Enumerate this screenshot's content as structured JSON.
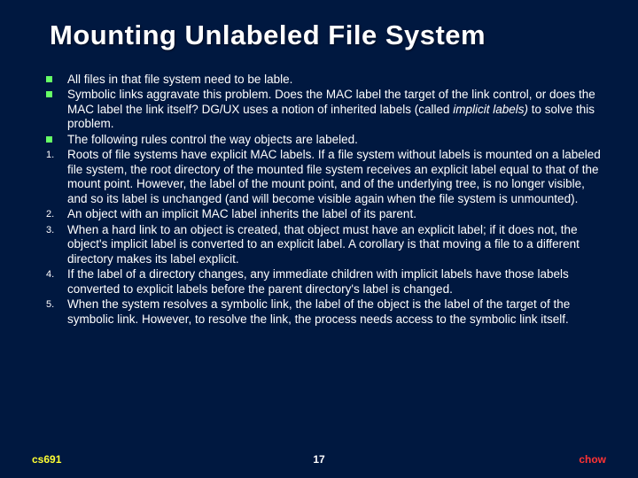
{
  "title": "Mounting Unlabeled File System",
  "bullets": {
    "b1": "All files in that file system need to be lable.",
    "b2a": "Symbolic links aggravate this problem. Does the MAC label the target of the link control, or does the MAC label the link itself? DG/UX uses a notion of inherited labels (called ",
    "b2_italic": "implicit labels)",
    "b2b": " to solve this problem.",
    "b3": "The following rules control the way objects are labeled."
  },
  "numbered": {
    "n1": "Roots of file systems have explicit MAC labels. If a file system without labels is mounted on a labeled file system, the root directory of the mounted file system receives an explicit label equal to that of the mount point. However, the label of the mount point, and of the underlying tree, is no longer visible, and so its label is unchanged (and will become visible again when the file system is unmounted).",
    "n2": "An object with an implicit MAC label inherits the label of its parent.",
    "n3": "When a hard link to an object is created, that object must have an explicit label; if it does not, the object's implicit label is converted to an explicit label. A corollary is that moving a file to a different directory makes its label explicit.",
    "n4": "If the label of a directory changes, any immediate children with implicit labels have those labels converted to explicit labels before the parent directory's label is changed.",
    "n5": "When the system resolves a symbolic link, the label of the object is the label of the target of the symbolic link. However, to resolve the link, the process needs access to the symbolic link itself."
  },
  "markers": {
    "m1": "1.",
    "m2": "2.",
    "m3": "3.",
    "m4": "4.",
    "m5": "5."
  },
  "footer": {
    "left": "cs691",
    "center": "17",
    "right": "chow"
  }
}
